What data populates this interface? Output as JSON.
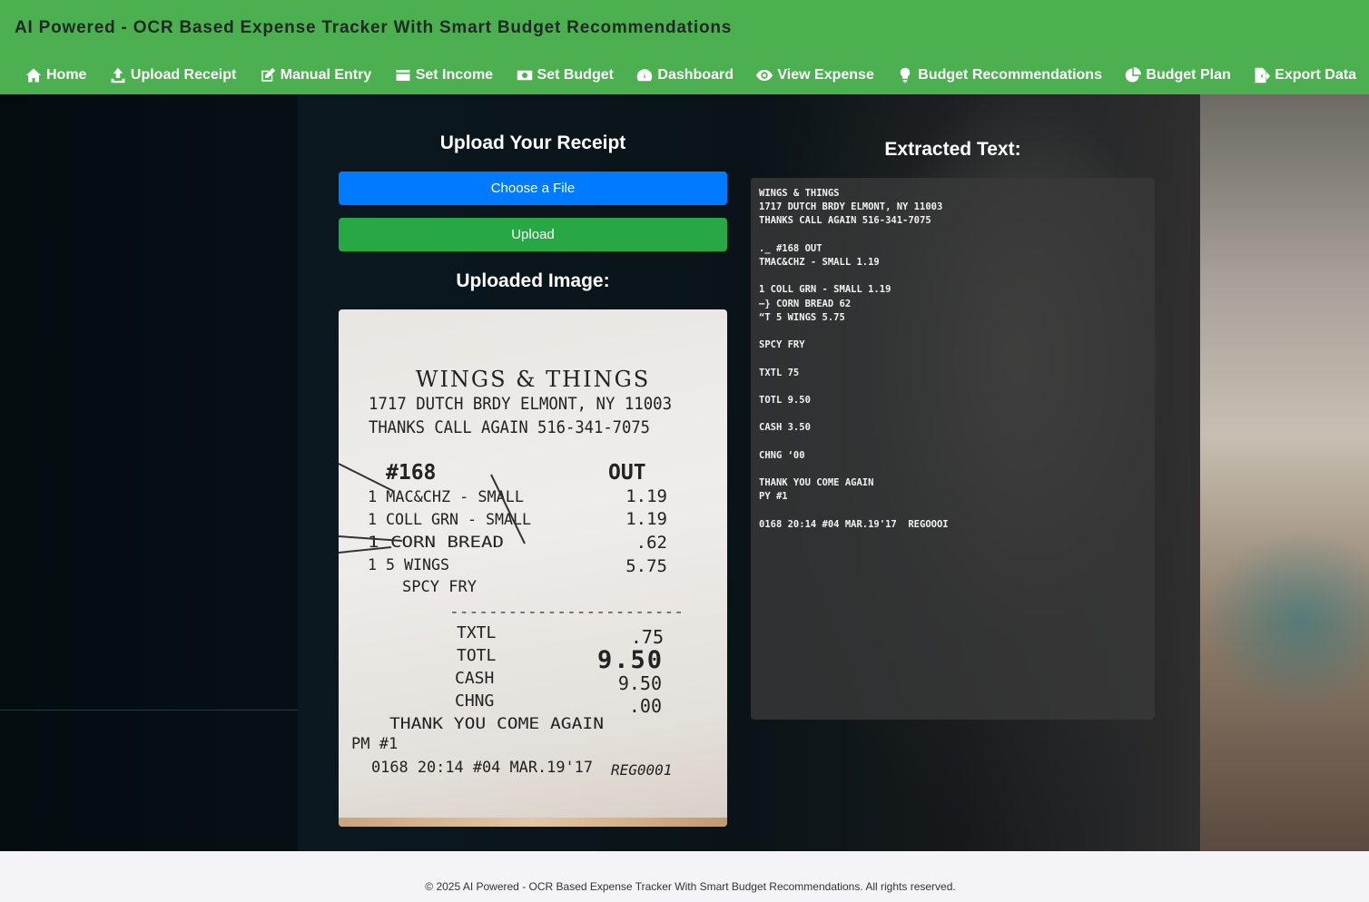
{
  "app": {
    "title": "AI Powered - OCR Based Expense Tracker With Smart Budget Recommendations"
  },
  "nav": [
    {
      "label": "Home",
      "icon": "home-icon"
    },
    {
      "label": "Upload Receipt",
      "icon": "upload-icon"
    },
    {
      "label": "Manual Entry",
      "icon": "edit-icon"
    },
    {
      "label": "Set Income",
      "icon": "wallet-icon"
    },
    {
      "label": "Set Budget",
      "icon": "money-icon"
    },
    {
      "label": "Dashboard",
      "icon": "gauge-icon"
    },
    {
      "label": "View Expense",
      "icon": "eye-icon"
    },
    {
      "label": "Budget Recommendations",
      "icon": "lightbulb-icon"
    },
    {
      "label": "Budget Plan",
      "icon": "pie-chart-icon"
    },
    {
      "label": "Export Data",
      "icon": "file-export-icon"
    }
  ],
  "upload": {
    "title": "Upload Your Receipt",
    "choose_label": "Choose a File",
    "upload_label": "Upload",
    "uploaded_title": "Uploaded Image:"
  },
  "receipt_image": {
    "store": "WINGS & THINGS",
    "address": "1717 DUTCH BRDY ELMONT, NY 11003",
    "thanks": "THANKS CALL AGAIN 516-341-7075",
    "order": "#168",
    "order_type": "OUT",
    "items": [
      {
        "name": "1 MAC&CHZ - SMALL",
        "price": "1.19"
      },
      {
        "name": "1 COLL GRN - SMALL",
        "price": "1.19"
      },
      {
        "name": "1 CORN  BREAD",
        "price": ".62"
      },
      {
        "name": "1 5 WINGS",
        "price": "5.75"
      },
      {
        "name": "SPCY FRY",
        "price": ""
      }
    ],
    "divider": "------------------------",
    "totals": [
      {
        "label": "TXTL",
        "value": ".75"
      },
      {
        "label": "TOTL",
        "value": "9.50"
      },
      {
        "label": "CASH",
        "value": "9.50"
      },
      {
        "label": "CHNG",
        "value": ".00"
      }
    ],
    "thank_you": "THANK YOU    COME AGAIN",
    "pm": "PM #1",
    "footer_line": "0168 20:14 #04 MAR.19'17",
    "register": "REG0001"
  },
  "extracted": {
    "title": "Extracted Text:",
    "text": "WINGS & THINGS\n1717 DUTCH BRDY ELMONT, NY 11003\nTHANKS CALL AGAIN 516-341-7075\n\n._ #168 OUT\nTMAC&CHZ - SMALL 1.19\n\n1 COLL GRN - SMALL 1.19\n—} CORN BREAD 62\n“T 5 WINGS 5.75\n\nSPCY FRY\n\nTXTL 75\n\nTOTL 9.50\n\nCASH 3.50\n\nCHNG ‘00\n\nTHANK YOU COME AGAIN\nPY #1\n\n0168 20:14 #04 MAR.19'17  REGOOOI"
  },
  "footer": {
    "text": "© 2025 AI Powered - OCR Based Expense Tracker With Smart Budget Recommendations. All rights reserved."
  }
}
